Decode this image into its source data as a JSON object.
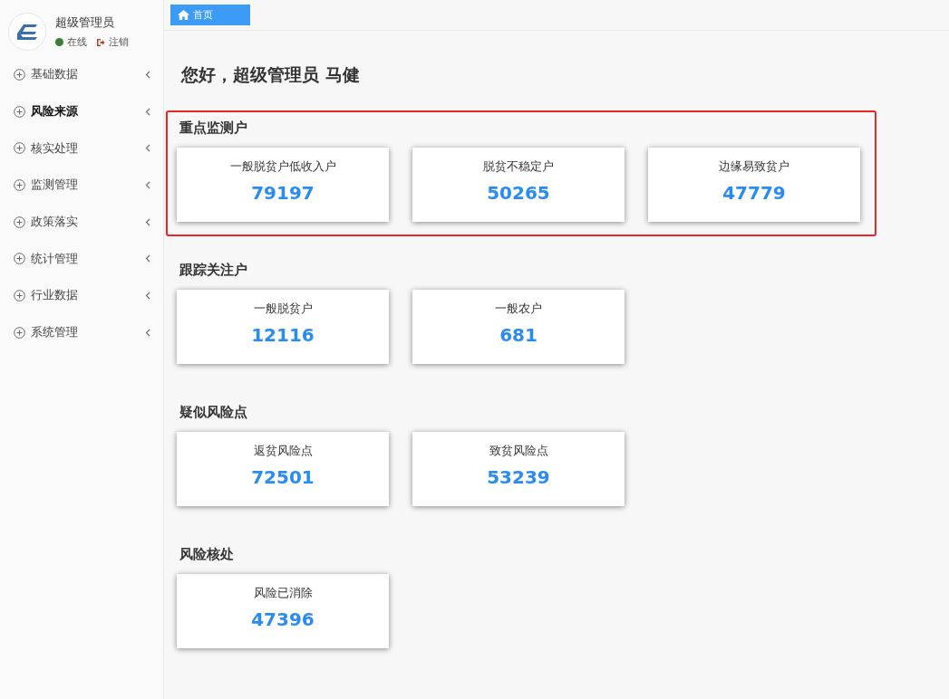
{
  "user": {
    "name": "超级管理员",
    "status": "在线",
    "logout": "注销"
  },
  "sidebar": {
    "items": [
      {
        "label": "基础数据",
        "selected": false
      },
      {
        "label": "风险来源",
        "selected": true
      },
      {
        "label": "核实处理",
        "selected": false
      },
      {
        "label": "监测管理",
        "selected": false
      },
      {
        "label": "政策落实",
        "selected": false
      },
      {
        "label": "统计管理",
        "selected": false
      },
      {
        "label": "行业数据",
        "selected": false
      },
      {
        "label": "系统管理",
        "selected": false
      }
    ]
  },
  "tabs": [
    {
      "label": "首页",
      "selected": true
    }
  ],
  "greeting": "您好，超级管理员 马健",
  "sections": [
    {
      "title": "重点监测户",
      "highlighted": true,
      "cards": [
        {
          "label": "一般脱贫户低收入户",
          "value": "79197"
        },
        {
          "label": "脱贫不稳定户",
          "value": "50265"
        },
        {
          "label": "边缘易致贫户",
          "value": "47779"
        }
      ]
    },
    {
      "title": "跟踪关注户",
      "highlighted": false,
      "cards": [
        {
          "label": "一般脱贫户",
          "value": "12116"
        },
        {
          "label": "一般农户",
          "value": "681"
        }
      ]
    },
    {
      "title": "疑似风险点",
      "highlighted": false,
      "cards": [
        {
          "label": "返贫风险点",
          "value": "72501"
        },
        {
          "label": "致贫风险点",
          "value": "53239"
        }
      ]
    },
    {
      "title": "风险核处",
      "highlighted": false,
      "cards": [
        {
          "label": "风险已消除",
          "value": "47396"
        }
      ]
    }
  ]
}
